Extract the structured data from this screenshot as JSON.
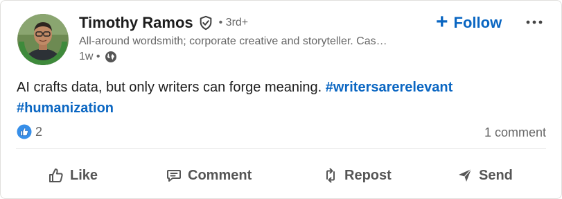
{
  "author": {
    "name": "Timothy Ramos",
    "connection_degree": "• 3rd+",
    "headline": "All-around wordsmith; corporate creative and storyteller. Cas…",
    "time_ago": "1w •",
    "avatar_badge_text": "#OPENTOWORK"
  },
  "follow": {
    "plus": "+",
    "label": "Follow"
  },
  "post": {
    "text": "AI crafts data, but only writers can forge meaning. ",
    "hashtags": [
      "#writersarerelevant",
      "#humanization"
    ]
  },
  "social": {
    "reaction_count": "2",
    "comments": "1 comment"
  },
  "actions": {
    "like": "Like",
    "comment": "Comment",
    "repost": "Repost",
    "send": "Send"
  },
  "colors": {
    "link_blue": "#0a66c2",
    "open_to_work_green": "#3e8a3b",
    "muted_text": "#666666"
  },
  "icons": [
    "verified-shield-icon",
    "globe-icon",
    "plus-icon",
    "more-dots-icon",
    "like-reaction-icon",
    "thumbs-up-icon",
    "comment-icon",
    "repost-icon",
    "send-icon"
  ]
}
